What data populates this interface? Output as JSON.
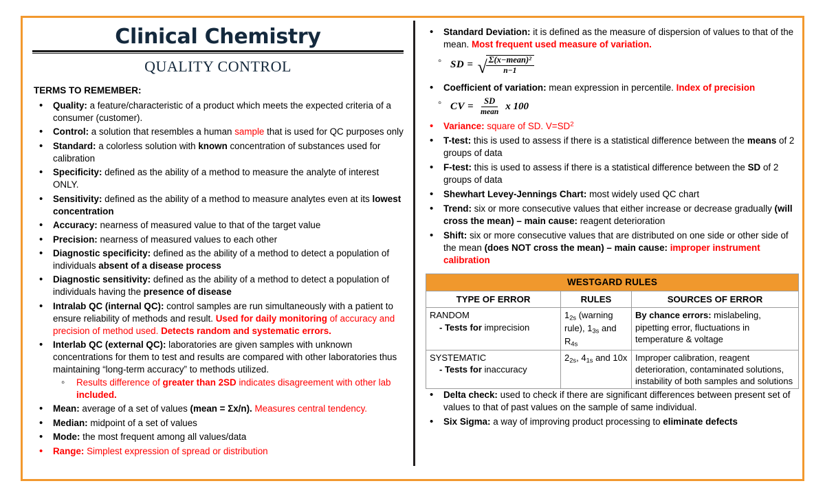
{
  "document": {
    "title": "Clinical Chemistry",
    "subtitle": "QUALITY CONTROL",
    "section_heading": "TERMS TO REMEMBER:",
    "border_color": "#F2982E",
    "title_color": "#14293d",
    "accent_red": "#FF0000",
    "table_header_color": "#F0982D"
  },
  "left_column": {
    "terms": [
      {
        "term": "Quality:",
        "definition": " a feature/characteristic of a product which meets the expected criteria of a consumer (customer)."
      },
      {
        "term": "Control:",
        "definition_pre": " a solution that resembles a human ",
        "highlight": "sample",
        "definition_post": " that is used for QC purposes only"
      },
      {
        "term": "Standard:",
        "definition_pre": " a colorless solution with ",
        "bold_mid": "known",
        "definition_post": " concentration of substances used for calibration"
      },
      {
        "term": "Specificity:",
        "definition": " defined as the ability of a method to measure the analyte of interest ONLY."
      },
      {
        "term": "Sensitivity:",
        "definition_pre": " defined as the ability of a method to measure analytes even at its ",
        "bold_tail": "lowest concentration"
      },
      {
        "term": "Accuracy:",
        "definition": " nearness of measured value to that of the target value"
      },
      {
        "term": "Precision:",
        "definition": " nearness of measured values to each other"
      },
      {
        "term": "Diagnostic specificity:",
        "definition_pre": " defined as the ability of a method to detect a population of individuals ",
        "bold_tail": "absent of a disease process"
      },
      {
        "term": "Diagnostic sensitivity:",
        "definition_pre": " defined as the ability of a method to detect a population of individuals having the ",
        "bold_tail": "presence of disease"
      },
      {
        "term": "Intralab QC (internal QC):",
        "definition_pre": " control samples are run simultaneously with a patient to ensure reliability of methods and result. ",
        "red_bold_1": "Used for daily monitoring",
        "red_plain_1": " of accuracy and precision of method used. ",
        "red_bold_2": "Detects random and systematic errors."
      },
      {
        "term": "Interlab QC (external QC):",
        "definition": " laboratories are given samples with unknown concentrations for them to test and results are compared with other laboratories thus maintaining “long-term accuracy” to methods utilized.",
        "subitem": {
          "red_plain_1": "Results difference of ",
          "red_bold_1": "greater than 2SD",
          "red_plain_2": " indicates disagreement with other lab ",
          "red_bold_2": "included."
        }
      },
      {
        "term": "Mean:",
        "definition_pre": " average of a set of values ",
        "bold_mid": "(mean = Σx/n).",
        "red_tail": " Measures central tendency."
      },
      {
        "term": "Median:",
        "definition": " midpoint of a set of values"
      },
      {
        "term": "Mode:",
        "definition": " the most frequent among all values/data"
      },
      {
        "term": "Range:",
        "definition": " Simplest expression of spread or distribution",
        "all_red": true
      }
    ]
  },
  "right_column": {
    "standard_deviation": {
      "term": "Standard Deviation:",
      "definition": " it is defined as the measure of dispersion of values to that of the mean. ",
      "red_tail": "Most frequent used measure of variation."
    },
    "sd_formula": {
      "lhs": "SD =",
      "radical": "√",
      "numerator": "Σ(x−mean)²",
      "denominator": "n−1"
    },
    "coefficient_of_variation": {
      "term": "Coefficient of variation:",
      "definition": " mean expression in percentile. ",
      "red_tail": "Index of precision"
    },
    "cv_formula": {
      "lhs": "CV =",
      "numerator": "SD",
      "denominator": "mean",
      "tail": "x 100"
    },
    "terms": [
      {
        "term": "Variance:",
        "definition": " square of SD.  V=SD",
        "superscript": "2",
        "all_red": true
      },
      {
        "term": "T-test:",
        "definition_pre": " this is used to assess if there is a statistical difference between the ",
        "bold_mid": "means",
        "definition_post": " of 2 groups of data"
      },
      {
        "term": "F-test:",
        "definition_pre": " this is used to assess if there is a statistical difference between the ",
        "bold_mid": "SD",
        "definition_post": " of 2 groups of data"
      },
      {
        "term": "Shewhart Levey-Jennings Chart:",
        "definition": " most widely used QC chart"
      },
      {
        "term": "Trend:",
        "definition_pre": " six or more consecutive values that either increase or decrease gradually ",
        "bold_mid": "(will cross the mean) – main cause:",
        "definition_post": " reagent deterioration"
      },
      {
        "term": "Shift:",
        "definition_pre": " six or more consecutive values that are distributed on one side or other side of the mean ",
        "bold_mid": "(does NOT cross the mean) – main cause:",
        "red_tail": " improper instrument calibration"
      }
    ],
    "westgard_table": {
      "title": "WESTGARD RULES",
      "headers": [
        "TYPE OF ERROR",
        "RULES",
        "SOURCES OF ERROR"
      ],
      "rows": [
        {
          "type_main": "RANDOM",
          "type_dash_bold": "- Tests for",
          "type_dash_plain": " imprecision",
          "rules": [
            {
              "base": "1",
              "sub": "2s",
              "tail": " (warning rule), "
            },
            {
              "base": "1",
              "sub": "3s",
              "tail": " and "
            },
            {
              "base": "R",
              "sub": "4s",
              "tail": ""
            }
          ],
          "source_bold": "By chance errors:",
          "source_plain": " mislabeling, pipetting error, fluctuations in temperature & voltage"
        },
        {
          "type_main": "SYSTEMATIC",
          "type_dash_bold": "- Tests for",
          "type_dash_plain": " inaccuracy",
          "rules": [
            {
              "base": "2",
              "sub": "2s",
              "tail": ", "
            },
            {
              "base": "4",
              "sub": "1s",
              "tail": " and "
            },
            {
              "base": "10x",
              "sub": "",
              "tail": ""
            }
          ],
          "source_bold": "",
          "source_plain": "Improper calibration, reagent deterioration, contaminated solutions, instability of both samples and solutions"
        }
      ]
    },
    "bottom_terms": [
      {
        "term": "Delta check:",
        "definition": " used to check if there are significant differences between present set of values to that of past values on the sample of same individual."
      },
      {
        "term": "Six Sigma:",
        "definition_pre": " a way of improving product processing to ",
        "bold_tail": "eliminate defects"
      }
    ]
  }
}
